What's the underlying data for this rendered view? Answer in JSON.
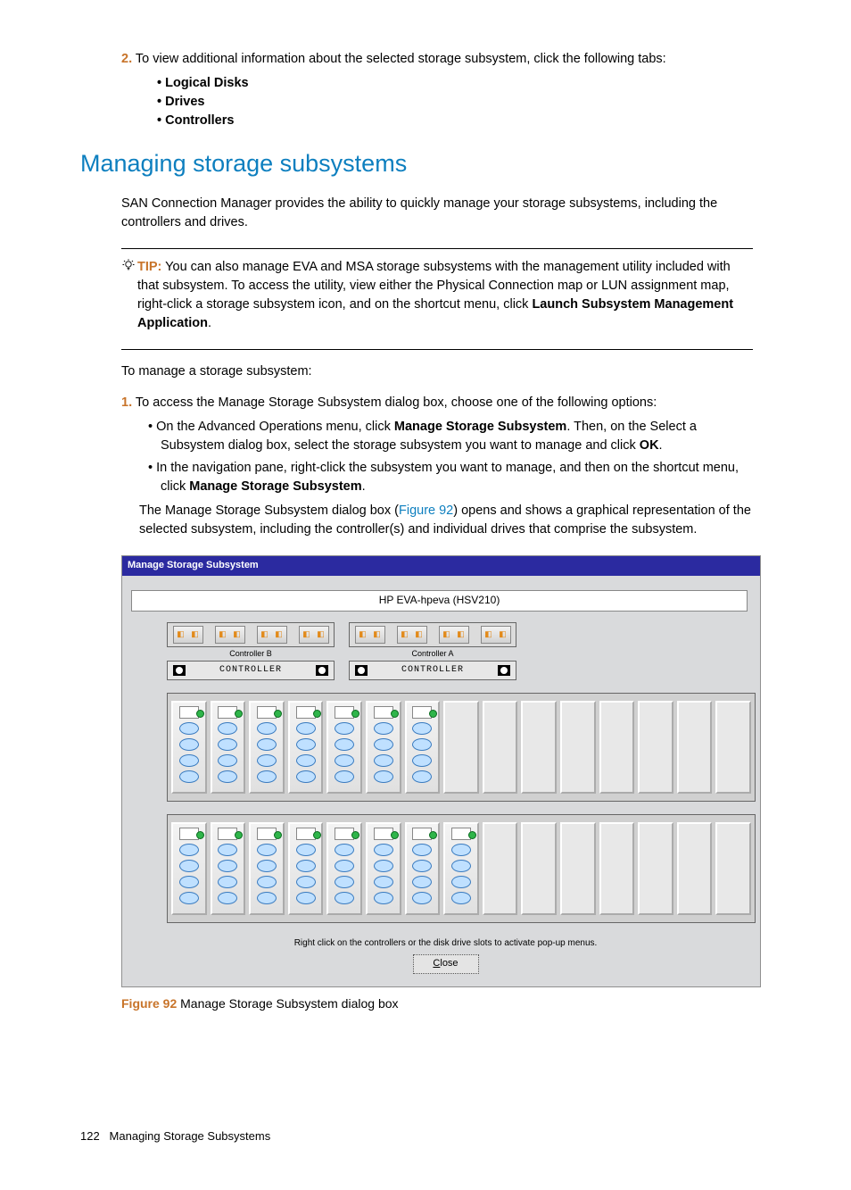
{
  "step2": {
    "num": "2.",
    "text": "To view additional information about the selected storage subsystem, click the following tabs:",
    "items": [
      "Logical Disks",
      "Drives",
      "Controllers"
    ]
  },
  "section_heading": "Managing storage subsystems",
  "intro": "SAN Connection Manager provides the ability to quickly manage your storage subsystems, including the controllers and drives.",
  "tip": {
    "label": "TIP:",
    "body_a": "You can also manage EVA and MSA storage subsystems with the management utility included with that subsystem. To access the utility, view either the Physical Connection map or LUN assignment map, right-click a storage subsystem icon, and on the shortcut menu, click ",
    "bold1": "Launch Subsystem Management Application",
    "body_b": "."
  },
  "manage_intro": "To manage a storage subsystem:",
  "step1": {
    "num": "1.",
    "text": "To access the Manage Storage Subsystem dialog box, choose one of the following options:",
    "opt_a_pre": "On the Advanced Operations menu, click ",
    "opt_a_b1": "Manage Storage Subsystem",
    "opt_a_mid": ". Then, on the Select a Subsystem dialog box, select the storage subsystem you want to manage and click ",
    "opt_a_b2": "OK",
    "opt_a_post": ".",
    "opt_b_pre": "In the navigation pane, right-click the subsystem you want to manage, and then on the shortcut menu, click ",
    "opt_b_b1": "Manage Storage Subsystem",
    "opt_b_post": "."
  },
  "result_para_a": "The Manage Storage Subsystem dialog box (",
  "result_link": "Figure 92",
  "result_para_b": ") opens and shows a graphical representation of the selected subsystem, including the controller(s) and individual drives that comprise the subsystem.",
  "dialog": {
    "title": "Manage Storage Subsystem",
    "header": "HP EVA-hpeva (HSV210)",
    "ctrl_b": "Controller B",
    "ctrl_a": "Controller A",
    "ctrl_word": "CONTROLLER",
    "hint": "Right click on the controllers or the disk drive slots to activate pop-up menus.",
    "close": "Close",
    "shelf1_filled": 7,
    "shelf2_filled": 8,
    "slots_total": 15
  },
  "figure": {
    "label": "Figure 92",
    "caption": " Manage Storage Subsystem dialog box"
  },
  "footer": {
    "page": "122",
    "title": "Managing Storage Subsystems"
  }
}
